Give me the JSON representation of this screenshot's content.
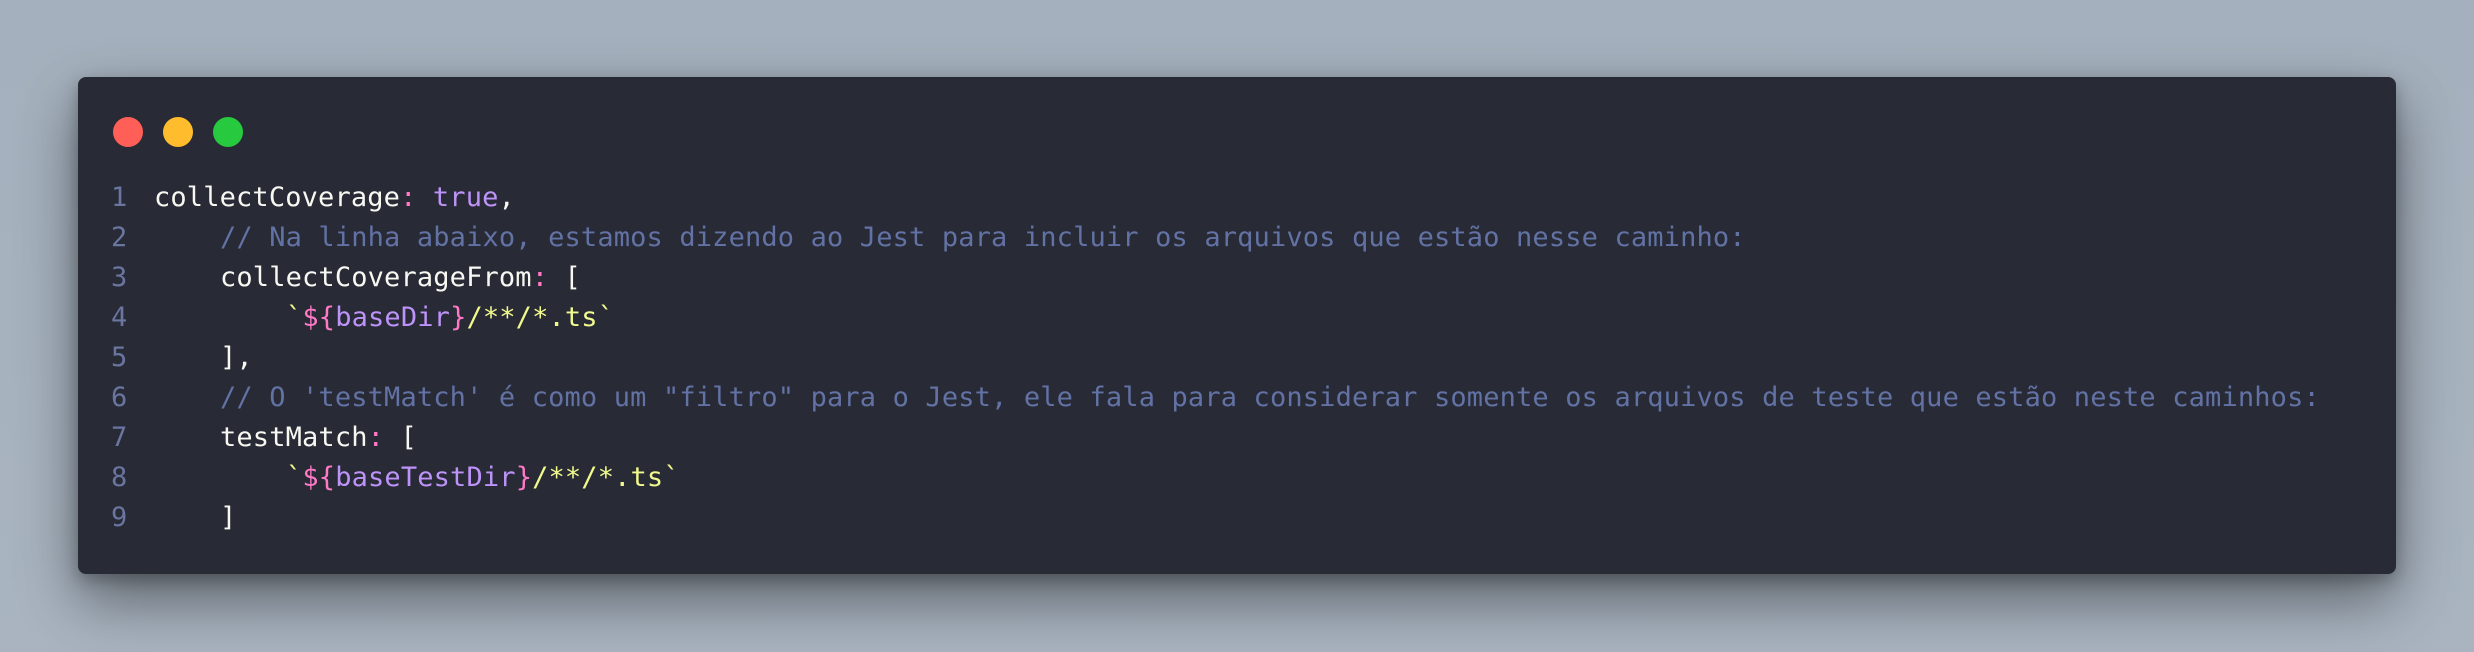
{
  "window_controls": {
    "close_color": "#ff5f56",
    "minimize_color": "#ffbd2e",
    "maximize_color": "#27c93f"
  },
  "code": {
    "line_numbers": [
      "1",
      "2",
      "3",
      "4",
      "5",
      "6",
      "7",
      "8",
      "9"
    ],
    "line1": {
      "prop": "collectCoverage",
      "colon": ":",
      "value": "true",
      "tail": ","
    },
    "line2": {
      "comment": "// Na linha abaixo, estamos dizendo ao Jest para incluir os arquivos que estão nesse caminho:"
    },
    "line3": {
      "prop": "collectCoverageFrom",
      "colon": ":",
      "tail": "["
    },
    "line4": {
      "tick_open": "`",
      "tpl_open": "${",
      "var": "baseDir",
      "tpl_close": "}",
      "rest": "/**/*.ts",
      "tick_close": "`"
    },
    "line5": {
      "text": "],"
    },
    "line6": {
      "comment": "// O 'testMatch' é como um \"filtro\" para o Jest, ele fala para considerar somente os arquivos de teste que estão neste caminhos:"
    },
    "line7": {
      "prop": "testMatch",
      "colon": ":",
      "tail": "["
    },
    "line8": {
      "tick_open": "`",
      "tpl_open": "${",
      "var": "baseTestDir",
      "tpl_close": "}",
      "rest": "/**/*.ts",
      "tick_close": "`"
    },
    "line9": {
      "text": "]"
    }
  },
  "theme": {
    "background": "#282a36",
    "comment": "#6272a4",
    "string": "#f1fa8c",
    "keyword": "#bd93f9",
    "punctuation": "#ff79c6",
    "foreground": "#f8f8f2"
  }
}
